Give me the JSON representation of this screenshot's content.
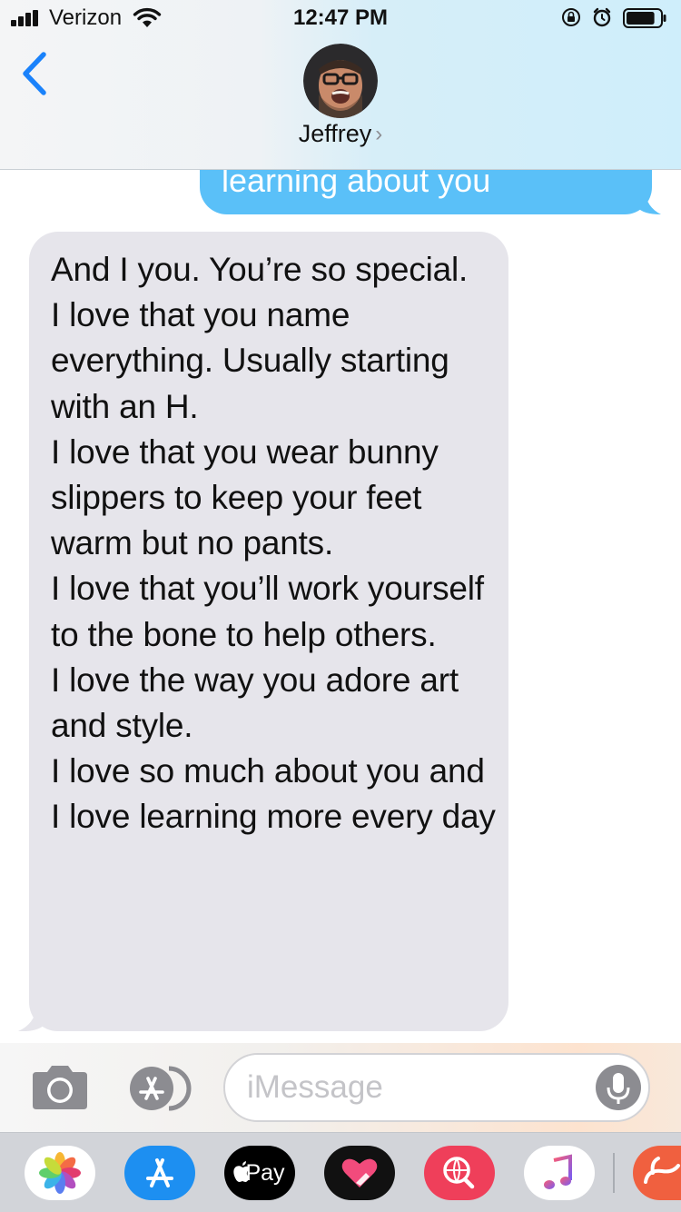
{
  "status_bar": {
    "carrier": "Verizon",
    "time": "12:47 PM",
    "battery_level": 0.85
  },
  "header": {
    "contact_name": "Jeffrey",
    "chevron": "›",
    "back_icon": "chevron-left-icon",
    "avatar": "contact-avatar"
  },
  "messages": [
    {
      "direction": "sent",
      "text": "learning about you"
    },
    {
      "direction": "received",
      "text": "And I you. You’re so special.\nI love that you name everything. Usually starting with an H.\nI love that you wear bunny slippers to keep your feet warm but no pants.\nI love that you’ll work yourself to the bone to help others.\nI love the way you adore art and style.\nI love so much about you and I love learning more every day"
    }
  ],
  "compose": {
    "placeholder": "iMessage",
    "camera_icon": "camera-icon",
    "apps_icon": "app-store-icon",
    "mic_icon": "microphone-icon"
  },
  "app_drawer": {
    "apps": [
      {
        "name": "photos",
        "icon": "photos-icon"
      },
      {
        "name": "app-store",
        "icon": "app-store-icon"
      },
      {
        "name": "apple-pay",
        "icon": "apple-pay-icon",
        "label": "Pay"
      },
      {
        "name": "digital-touch",
        "icon": "heart-icon"
      },
      {
        "name": "search",
        "icon": "globe-search-icon"
      },
      {
        "name": "music",
        "icon": "music-note-icon"
      },
      {
        "name": "more-app",
        "icon": "rabbit-icon"
      }
    ]
  },
  "colors": {
    "sent_bubble": "#5ac0f8",
    "received_bubble": "#e6e5eb",
    "ios_blue": "#1a82fb",
    "drawer_background": "#d2d4d9"
  }
}
